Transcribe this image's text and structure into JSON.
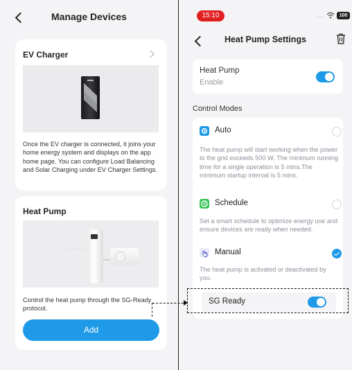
{
  "left": {
    "title": "Manage Devices",
    "ev_card": {
      "title": "EV Charger",
      "description": "Once the EV charger is connected, it joins your home energy system and displays on the app home page. You can configure Load Balancing and Solar Charging under EV Charger Settings."
    },
    "hp_card": {
      "title": "Heat Pump",
      "description": "Control the heat pump through the SG-Ready protocol.",
      "button": "Add"
    }
  },
  "status_bar": {
    "time": "15:10",
    "battery": "100"
  },
  "right": {
    "title": "Heat Pump Settings",
    "heat_pump": {
      "label": "Heat Pump",
      "sub": "Enable",
      "enabled": true
    },
    "section_label": "Control Modes",
    "modes": [
      {
        "label": "Auto",
        "icon": "auto-icon",
        "description": "The heat pump will start working when the power to the grid exceeds 500 W. The minimum running time for a single operation is 5 mins.The minimum startup interval is 5 mins.",
        "selected": false
      },
      {
        "label": "Schedule",
        "icon": "schedule-icon",
        "description": "Set a smart schedule to optimize energy use and ensure devices are ready when needed.",
        "selected": false
      },
      {
        "label": "Manual",
        "icon": "manual-icon",
        "description": "The heat pump is activated or deactivated by you.",
        "selected": true
      }
    ],
    "sg_ready": {
      "label": "SG Ready",
      "enabled": true
    }
  },
  "colors": {
    "accent": "#1e9ae8",
    "background": "#f4f4f6",
    "status_time_bg": "#e02020",
    "schedule_icon": "#3cc35a"
  }
}
